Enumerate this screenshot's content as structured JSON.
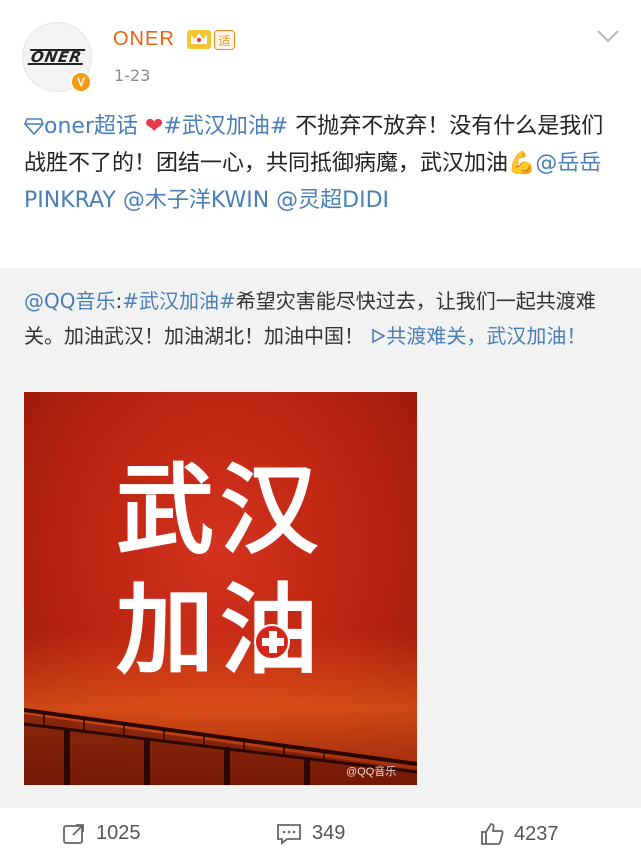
{
  "header": {
    "avatar_logo": "ONER",
    "verified_badge": "V",
    "username": "ONER",
    "tag": "适",
    "date": "1-23",
    "icons": [
      "crown-icon",
      "tag-icon",
      "chevron-down-icon"
    ]
  },
  "post": {
    "supertopic": "oner超话",
    "hashtag": "#武汉加油#",
    "text_1": " 不抛弃不放弃！没有什么是我们战胜不了的！团结一心，共同抵御病魔，武汉加油",
    "mention_1": "@岳岳PINKRAY",
    "mention_2": "@木子洋KWIN",
    "mention_3": "@灵超DIDI"
  },
  "repost": {
    "author": "@QQ音乐",
    "hashtag": "#武汉加油#",
    "text": "希望灾害能尽快过去，让我们一起共渡难关。加油武汉！加油湖北！加油中国！",
    "video_link": "共渡难关，武汉加油！",
    "image": {
      "line1_a": "武",
      "line1_b": "汉",
      "line2_a": "加",
      "line2_b": "油",
      "watermark": "@QQ音乐"
    }
  },
  "actions": {
    "reposts": "1025",
    "comments": "349",
    "likes": "4237"
  },
  "colors": {
    "username": "#f2600c",
    "link": "#4a7eb8",
    "poster_red": "#c02a14",
    "badge": "#f59a14"
  }
}
